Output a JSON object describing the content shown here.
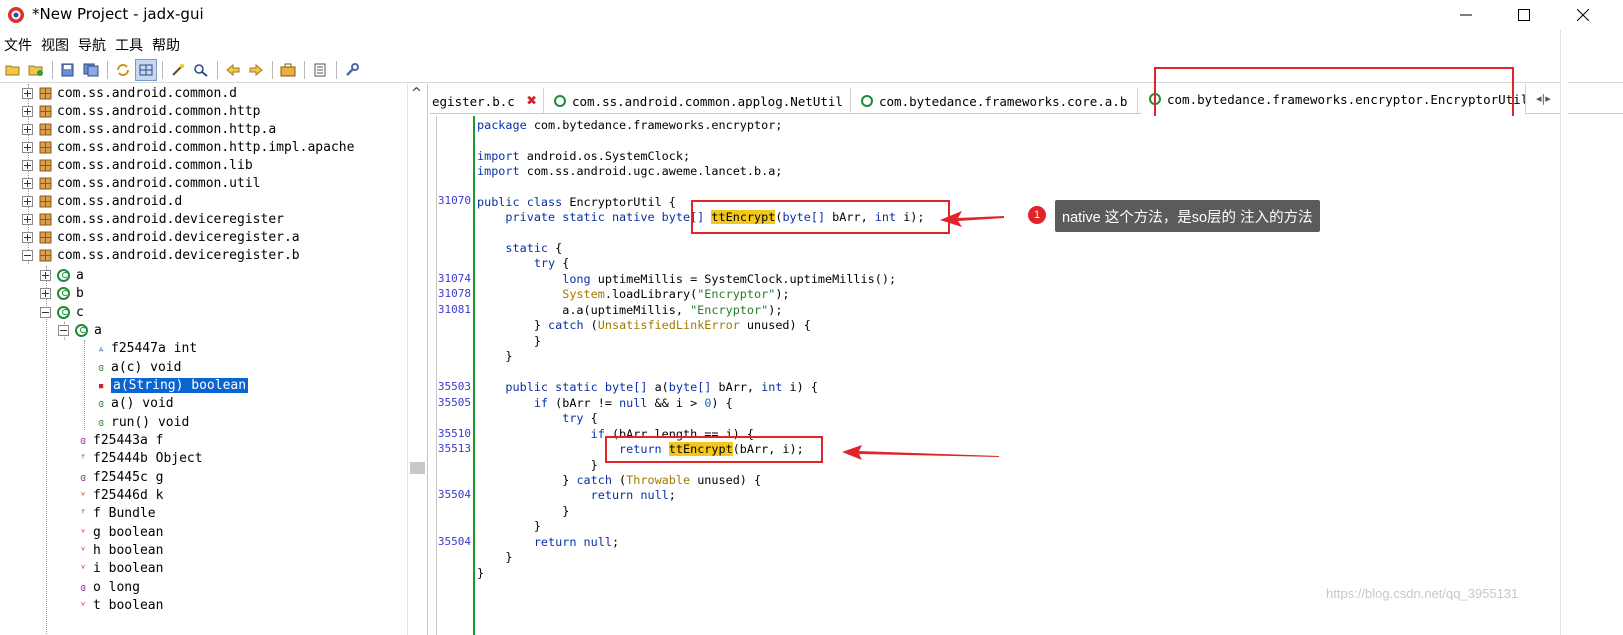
{
  "window": {
    "title": "*New Project - jadx-gui",
    "min_glyph": "—",
    "max_glyph": "☐",
    "close_glyph": "✕"
  },
  "menu": [
    "文件",
    "视图",
    "导航",
    "工具",
    "帮助"
  ],
  "toolbar_icons": [
    "open-folder-icon",
    "add-files-icon",
    "sep",
    "save-icon",
    "save-all-icon",
    "sep",
    "sync-icon",
    "flatten-icon",
    "sep",
    "decompile-icon",
    "search-icon",
    "sep",
    "back-icon",
    "forward-icon",
    "sep",
    "preferences-icon",
    "sep",
    "log-icon",
    "sep",
    "settings-icon"
  ],
  "tree": {
    "packages": [
      "com.ss.android.common.d",
      "com.ss.android.common.http",
      "com.ss.android.common.http.a",
      "com.ss.android.common.http.impl.apache",
      "com.ss.android.common.lib",
      "com.ss.android.common.util",
      "com.ss.android.d",
      "com.ss.android.deviceregister",
      "com.ss.android.deviceregister.a",
      "com.ss.android.deviceregister.b"
    ],
    "classes": [
      "a",
      "b",
      "c",
      "a"
    ],
    "members_a": [
      "f25447a int",
      "a(c) void",
      "a(String) boolean",
      "a() void",
      "run() void"
    ],
    "members_c": [
      "f25443a f",
      "f25444b Object",
      "f25445c g",
      "f25446d k",
      "f Bundle",
      "g boolean",
      "h boolean",
      "i boolean",
      "o long",
      "t boolean"
    ],
    "scroll_up": "^"
  },
  "tabs": [
    {
      "label": "egister.b.c",
      "icon": false
    },
    {
      "label": "com.ss.android.common.applog.NetUtil",
      "icon": true
    },
    {
      "label": "com.bytedance.frameworks.core.a.b",
      "icon": true
    },
    {
      "label": "com.bytedance.frameworks.encryptor.EncryptorUtil",
      "icon": true
    }
  ],
  "tab_close": "✖",
  "tab_scroll": "◂|▸",
  "code": {
    "line_numbers": [
      "31070",
      "31074",
      "31078",
      "31081",
      "35503",
      "35505",
      "35510",
      "35513",
      "35504",
      "35504"
    ],
    "package_kw": "package",
    "package_name": " com.bytedance.frameworks.encryptor;",
    "import_kw": "import",
    "import1": " android.os.SystemClock;",
    "import2": " com.ss.android.ugc.aweme.lancet.b.a;",
    "public_class": "public class",
    "class_name": " EncryptorUtil {",
    "l_native_pre": "    private static native ",
    "l_native_type": "byte[]",
    "l_native_sp": " ",
    "method_name": "ttEncrypt",
    "l_native_args1": "(",
    "l_native_args2": "byte[]",
    "l_native_args3": " bArr, ",
    "l_native_args4": "int",
    "l_native_args5": " i);",
    "static_kw": "    static",
    "static_brace": " {",
    "try_kw": "        try",
    "try_brace": " {",
    "l_long_kw": "            long",
    "l_long_rest": " uptimeMillis = SystemClock.uptimeMillis();",
    "l_sys": "            System",
    "l_sys_rest": ".loadLibrary(",
    "lib_str": "\"Encryptor\"",
    "l_sys_end": ");",
    "l_aa": "            a.a(uptimeMillis, ",
    "l_aa_end": ");",
    "catch_close": "        } ",
    "catch_kw": "catch",
    "catch_paren": " (",
    "catch_exc": "UnsatisfiedLinkError",
    "catch_rest": " unused) {",
    "close_brace_8": "        }",
    "close_brace_4": "    }",
    "l_pub_a_kw": "    public static",
    "l_pub_a_type": " byte[]",
    "l_pub_a_rest1": " a(",
    "l_pub_a_type2": "byte[]",
    "l_pub_a_rest2": " bArr, ",
    "l_pub_a_int": "int",
    "l_pub_a_rest3": " i) {",
    "l_if1_kw": "        if",
    "l_if1_rest1": " (bArr != ",
    "null_kw": "null",
    "l_if1_rest2": " && i > ",
    "zero": "0",
    "l_if1_rest3": ") {",
    "try2": "            try",
    "l_if2_kw": "                if",
    "l_if2_rest": " (bArr.length == i) {",
    "ret_kw": "                    return",
    "ret_sp": " ",
    "ret_rest": "(bArr, i);",
    "close_16": "                }",
    "catch2_pre": "            } ",
    "catch2_exc": "Throwable",
    "catch2_rest": " unused) {",
    "ret_null_kw": "                return",
    "ret_null_end": ";",
    "close_12": "            }",
    "ret2_kw": "        return",
    "ret2_end": ";",
    "close_class": "}"
  },
  "callout": {
    "number": "1",
    "text": "native 这个方法，是so层的 注入的方法"
  },
  "watermark": "https://blog.csdn.net/qq_3955131"
}
